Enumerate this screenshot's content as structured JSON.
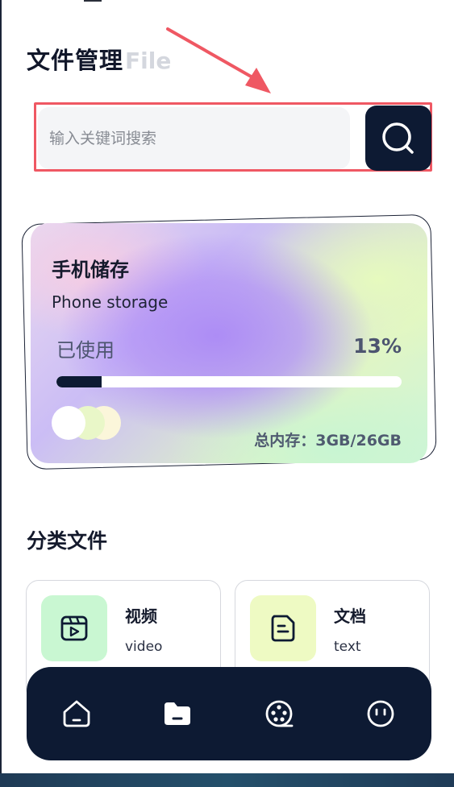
{
  "header": {
    "title": "文件管理",
    "title_ghost": "File"
  },
  "search": {
    "placeholder": "输入关键词搜索",
    "button_icon": "search-icon"
  },
  "storage": {
    "title": "手机储存",
    "subtitle": "Phone storage",
    "used_label": "已使用",
    "used_percent_text": "13%",
    "used_fraction": 0.13,
    "total_text": "总内存：3GB/26GB"
  },
  "categories": {
    "title": "分类文件",
    "items": [
      {
        "name": "视频",
        "sub": "video",
        "icon": "video-file-icon",
        "color": "#c9f7d2"
      },
      {
        "name": "文档",
        "sub": "text",
        "icon": "document-icon",
        "color": "#eefac3"
      }
    ]
  },
  "nav": {
    "items": [
      {
        "icon": "home-icon"
      },
      {
        "icon": "folder-icon"
      },
      {
        "icon": "film-reel-icon"
      },
      {
        "icon": "profile-icon"
      }
    ]
  },
  "colors": {
    "accent": "#0d1a33",
    "highlight": "#ef5863"
  }
}
